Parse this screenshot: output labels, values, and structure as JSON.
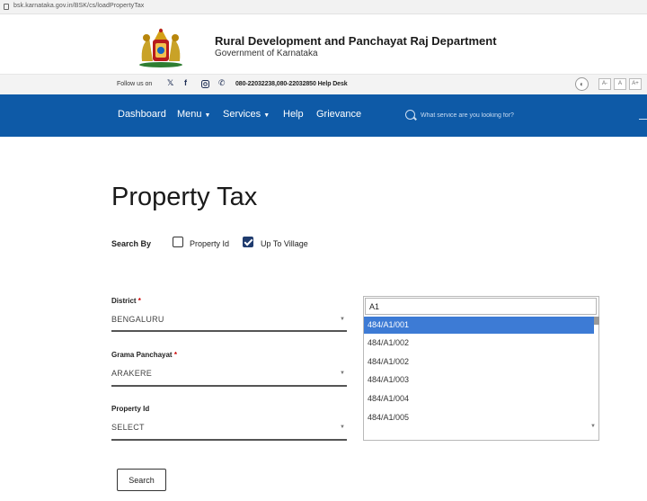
{
  "browser": {
    "url": "bsk.karnataka.gov.in/BSK/cs/loadPropertyTax"
  },
  "header": {
    "title": "Rural Development and Panchayat Raj Department",
    "subtitle": "Government of Karnataka",
    "logo": "karnataka-emblem"
  },
  "topbar": {
    "follow_label": "Follow us on",
    "social_icons": [
      "twitter-icon",
      "facebook-icon",
      "instagram-icon",
      "phone-icon"
    ],
    "helpdesk": "080-22032238,080-22032850 Help Desk",
    "contrast_label": "◐",
    "font_sizes": [
      "A-",
      "A",
      "A+"
    ]
  },
  "nav": {
    "items": [
      {
        "label": "Dashboard"
      },
      {
        "label": "Menu",
        "dropdown": true
      },
      {
        "label": "Services",
        "dropdown": true
      },
      {
        "label": "Help"
      },
      {
        "label": "Grievance"
      }
    ],
    "search_placeholder": "What service are you looking for?"
  },
  "page": {
    "title": "Property Tax"
  },
  "search_by": {
    "label": "Search By",
    "options": [
      {
        "label": "Property Id",
        "checked": false
      },
      {
        "label": "Up To Village",
        "checked": true
      }
    ]
  },
  "form": {
    "district": {
      "label": "District",
      "required_mark": "*",
      "value": "BENGALURU"
    },
    "grama_panchayat": {
      "label": "Grama Panchayat",
      "required_mark": "*",
      "value": "ARAKERE"
    },
    "property_id": {
      "label": "Property Id",
      "value": "SELECT"
    },
    "search_button": "Search"
  },
  "dropdown": {
    "query": "A1",
    "options": [
      "484/A1/001",
      "484/A1/002",
      "484/A1/002",
      "484/A1/003",
      "484/A1/004",
      "484/A1/005"
    ],
    "highlighted_index": 0
  },
  "colors": {
    "nav_bg": "#0e5aa7",
    "highlight": "#3d7bd5",
    "checkbox": "#1f3b6e"
  }
}
